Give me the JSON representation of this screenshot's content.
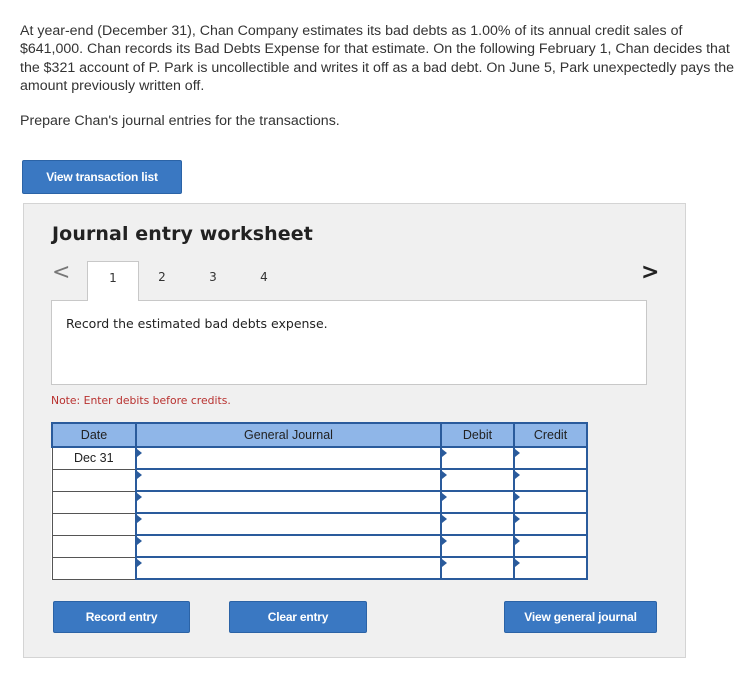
{
  "problem_text": "At year-end (December 31), Chan Company estimates its bad debts as 1.00% of its annual credit sales of $641,000. Chan records its Bad Debts Expense for that estimate. On the following February 1, Chan decides that the $321 account of P. Park is uncollectible and writes it off as a bad debt. On June 5, Park unexpectedly pays the amount previously written off.",
  "instruction_text": "Prepare Chan's journal entries for the transactions.",
  "view_transaction_list_label": "View transaction list",
  "worksheet": {
    "title": "Journal entry worksheet",
    "nav_prev": "<",
    "nav_next": ">",
    "tabs": [
      "1",
      "2",
      "3",
      "4"
    ],
    "active_tab": "1",
    "panel_text": "Record the estimated bad debts expense.",
    "note": "Note: Enter debits before credits.",
    "table": {
      "headers": {
        "date": "Date",
        "journal": "General Journal",
        "debit": "Debit",
        "credit": "Credit"
      },
      "rows": [
        {
          "date": "Dec 31",
          "journal": "",
          "debit": "",
          "credit": ""
        },
        {
          "date": "",
          "journal": "",
          "debit": "",
          "credit": ""
        },
        {
          "date": "",
          "journal": "",
          "debit": "",
          "credit": ""
        },
        {
          "date": "",
          "journal": "",
          "debit": "",
          "credit": ""
        },
        {
          "date": "",
          "journal": "",
          "debit": "",
          "credit": ""
        },
        {
          "date": "",
          "journal": "",
          "debit": "",
          "credit": ""
        }
      ]
    },
    "record_entry_label": "Record entry",
    "clear_entry_label": "Clear entry",
    "view_general_journal_label": "View general journal"
  },
  "colors": {
    "button_blue": "#3a78c2",
    "header_blue": "#8fb6e8",
    "border_blue": "#2a5b9c",
    "note_red": "#b8312f"
  }
}
